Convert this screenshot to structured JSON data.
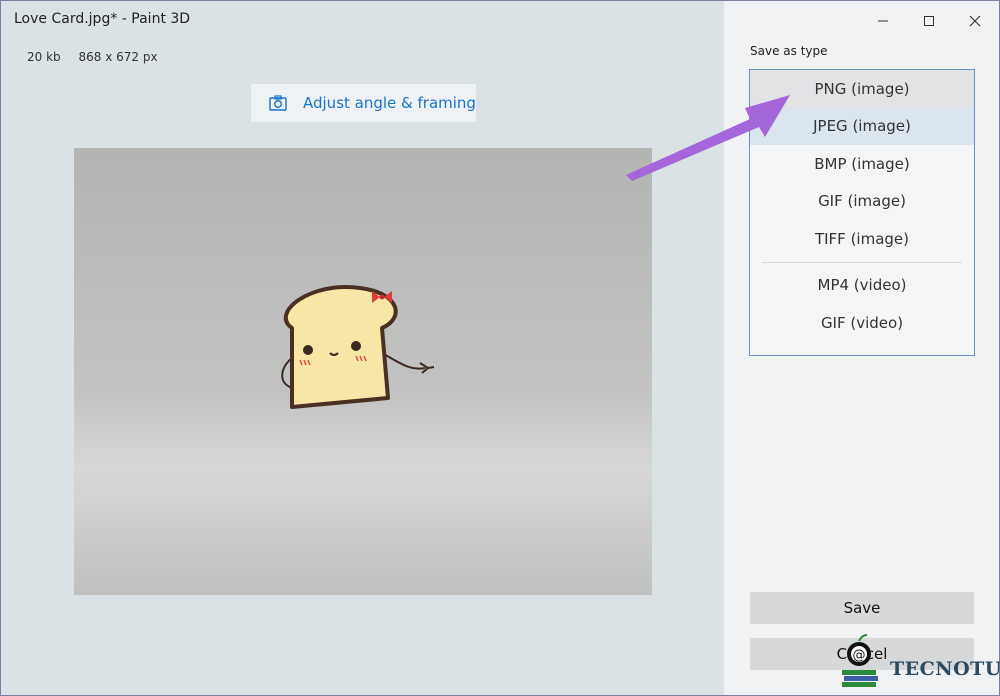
{
  "window": {
    "title": "Love Card.jpg* - Paint 3D"
  },
  "file_info": {
    "size": "20 kb",
    "dimensions": "868 x 672 px"
  },
  "adjust_button": {
    "label": "Adjust angle & framing",
    "icon": "camera-icon"
  },
  "save_as_type": {
    "label": "Save as type",
    "options": [
      {
        "label": "PNG (image)",
        "state": "hover"
      },
      {
        "label": "JPEG (image)",
        "state": "selected"
      },
      {
        "label": "BMP (image)"
      },
      {
        "label": "GIF (image)"
      },
      {
        "label": "TIFF (image)"
      },
      {
        "label": "MP4 (video)"
      },
      {
        "label": "GIF (video)"
      }
    ]
  },
  "actions": {
    "save": "Save",
    "cancel": "Cancel"
  },
  "watermark": {
    "text": "TECNOTUTO"
  },
  "colors": {
    "accent": "#1a73c6",
    "arrow": "#a466d9",
    "list_border": "#6c8ec9"
  }
}
